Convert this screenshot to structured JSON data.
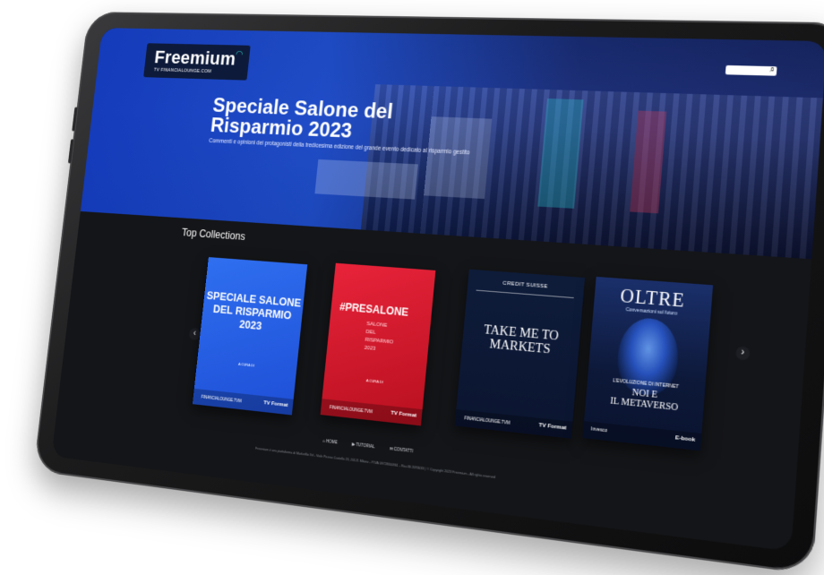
{
  "logo": {
    "name": "Freemium",
    "subtitle": "TV FINANCIALOUNGE.COM"
  },
  "hero": {
    "title": "Speciale Salone del Risparmio 2023",
    "subtitle": "Commenti e opinioni dei protagonisti della tredicesima edizione del grande evento dedicato al risparmio gestito"
  },
  "collections": {
    "title": "Top Collections",
    "items": [
      {
        "title": "SPECIALE SALONE DEL RISPARMIO 2023",
        "curator": "A CURA DI",
        "brand": "FINANCIALOUNGE.TVM",
        "format": "TV Format"
      },
      {
        "title": "#PRESALONE",
        "subtitle": "SALONE\nDEL\nRISPARMIO\n2023",
        "curator": "A CURA DI",
        "brand": "FINANCIALOUNGE.TVM",
        "format": "TV Format"
      },
      {
        "brand_top": "CREDIT SUISSE",
        "title": "TAKE ME TO MARKETS",
        "brand": "FINANCIALOUNGE.TVM",
        "format": "TV Format"
      },
      {
        "title": "OLTRE",
        "subtitle": "Conversazioni sul futuro",
        "kicker": "L'EVOLUZIONE DI INTERNET",
        "main": "NOI E\nIL METAVERSO",
        "brand": "Invesco",
        "format": "E-book"
      }
    ]
  },
  "nav": {
    "items": [
      "HOME",
      "TUTORIAL",
      "CONTATTI"
    ]
  },
  "footer": {
    "text": "Freemium è una piattaforma di Marketflix Srl - Viale Piceno Castello 23, 20121 Milano - P.IVA 09728300961 - Rea Mi 2093033 | © Copyright 2023 Freemium - All rights reserved"
  },
  "colors": {
    "accent": "#2f6ff0",
    "presalone": "#e8233a",
    "background": "#141518"
  }
}
